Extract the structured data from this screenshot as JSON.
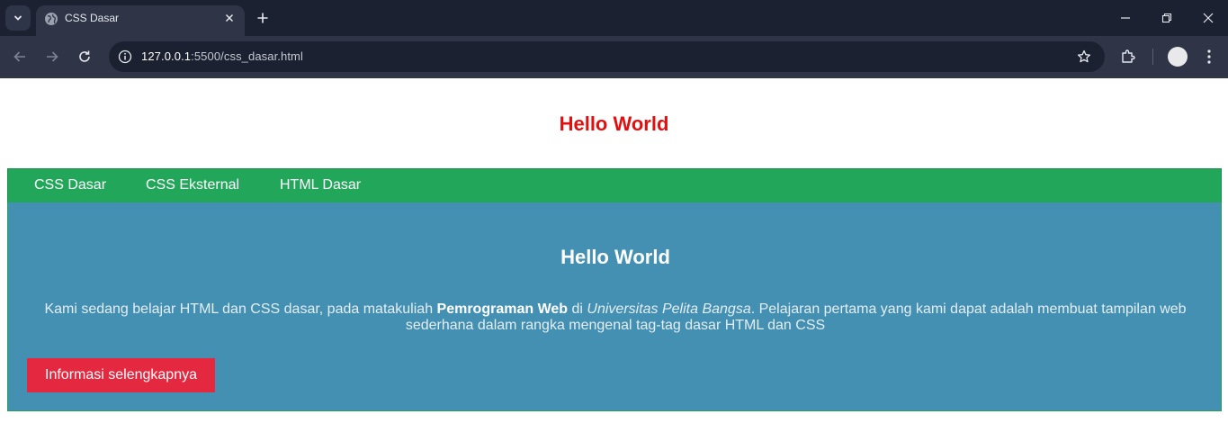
{
  "browser": {
    "tab_title": "CSS Dasar",
    "url_host": "127.0.0.1",
    "url_path": ":5500/css_dasar.html"
  },
  "page": {
    "title": "Hello World",
    "nav": [
      {
        "label": "CSS Dasar"
      },
      {
        "label": "CSS Eksternal"
      },
      {
        "label": "HTML Dasar"
      }
    ],
    "hero": {
      "title": "Hello World",
      "text_part1": "Kami sedang belajar HTML dan CSS dasar, pada matakuliah ",
      "text_bold": "Pemrograman Web",
      "text_part2": " di ",
      "text_italic": "Universitas Pelita Bangsa",
      "text_part3": ". Pelajaran pertama yang kami dapat adalah membuat tampilan web sederhana dalam rangka mengenal tag-tag dasar HTML dan CSS",
      "button_label": "Informasi selengkapnya"
    }
  },
  "colors": {
    "title_red": "#e30f0f",
    "nav_green": "#22a75a",
    "hero_blue": "#4390b3",
    "button_red": "#e4283f"
  }
}
